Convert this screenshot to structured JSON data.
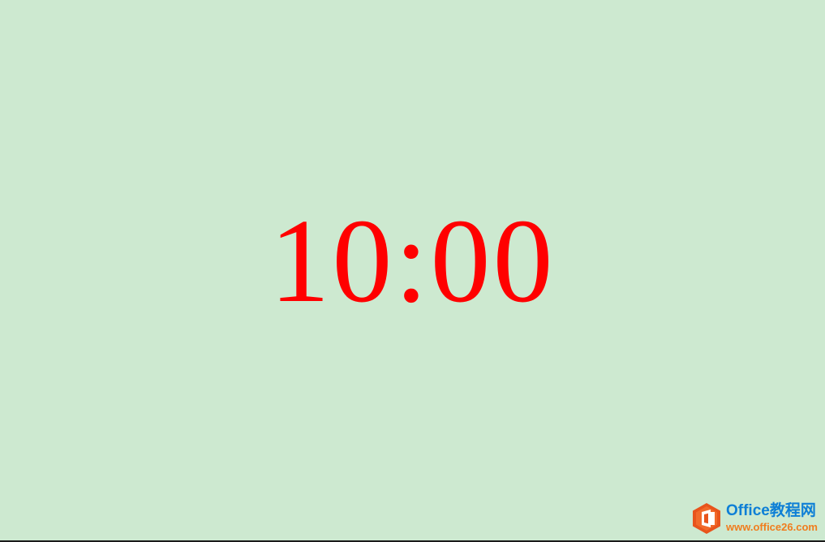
{
  "clock": {
    "time": "10:00",
    "color": "#ff0000"
  },
  "background_color": "#cde9d0",
  "watermark": {
    "logo_icon": "office-logo-icon",
    "title": "Office教程网",
    "url": "www.office26.com",
    "title_color": "#0e7fd6",
    "url_color": "#f07d1e",
    "logo_color": "#e8541c"
  }
}
